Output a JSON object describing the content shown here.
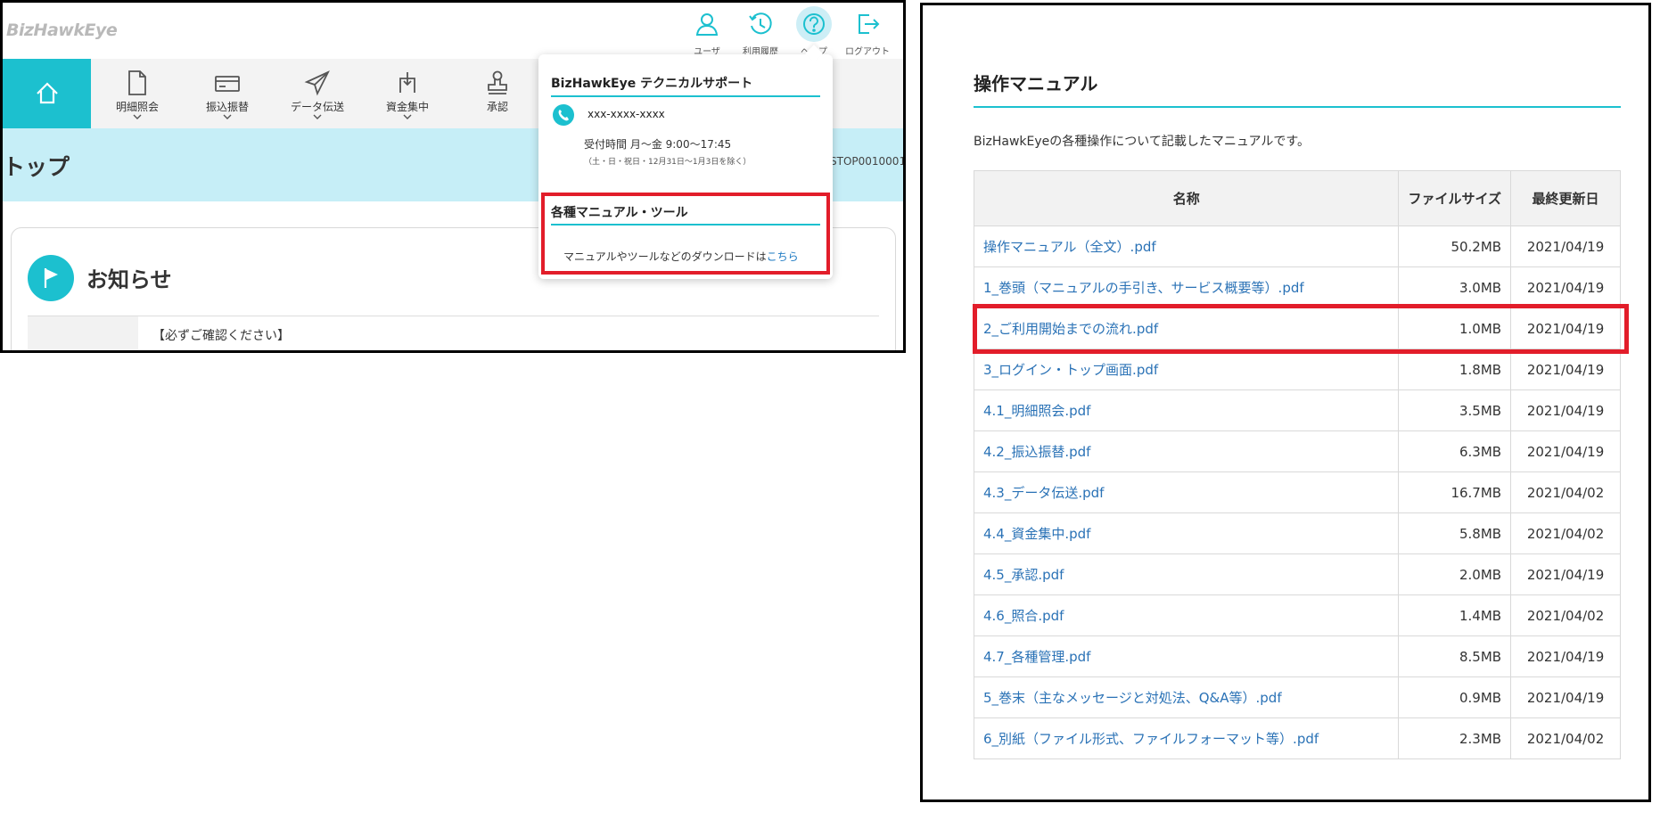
{
  "app": {
    "logo": "BizHawkEye"
  },
  "util_nav": [
    {
      "label": "ユーザ",
      "icon": "user-icon"
    },
    {
      "label": "利用履歴",
      "icon": "history-icon"
    },
    {
      "label": "ヘルプ",
      "icon": "help-icon"
    },
    {
      "label": "ログアウト",
      "icon": "logout-icon"
    }
  ],
  "main_menu": [
    {
      "label": "明細照会",
      "icon": "document-icon",
      "has_chevron": true
    },
    {
      "label": "振込振替",
      "icon": "card-icon",
      "has_chevron": true
    },
    {
      "label": "データ伝送",
      "icon": "paper-plane-icon",
      "has_chevron": true
    },
    {
      "label": "資金集中",
      "icon": "fund-concentrate-icon",
      "has_chevron": true
    },
    {
      "label": "承認",
      "icon": "stamp-icon",
      "has_chevron": false
    }
  ],
  "page": {
    "title": "トップ",
    "screen_id": "STOP0010001"
  },
  "notice": {
    "title": "お知らせ",
    "text": "【必ずご確認ください】"
  },
  "help_popover": {
    "support_heading": "BizHawkEye テクニカルサポート",
    "phone": "xxx-xxxx-xxxx",
    "hours": "受付時間 月～金 9:00～17:45",
    "hours_note": "（土・日・祝日・12月31日～1月3日を除く）",
    "manual_heading": "各種マニュアル・ツール",
    "manual_text": "マニュアルやツールなどのダウンロードは",
    "manual_link": "こちら"
  },
  "manual_page": {
    "title": "操作マニュアル",
    "description": "BizHawkEyeの各種操作について記載したマニュアルです。",
    "columns": [
      "名称",
      "ファイルサイズ",
      "最終更新日"
    ],
    "rows": [
      {
        "name": "操作マニュアル（全文）.pdf",
        "size": "50.2MB",
        "date": "2021/04/19"
      },
      {
        "name": "1_巻頭（マニュアルの手引き、サービス概要等）.pdf",
        "size": "3.0MB",
        "date": "2021/04/19"
      },
      {
        "name": "2_ご利用開始までの流れ.pdf",
        "size": "1.0MB",
        "date": "2021/04/19"
      },
      {
        "name": "3_ログイン・トップ画面.pdf",
        "size": "1.8MB",
        "date": "2021/04/19"
      },
      {
        "name": "4.1_明細照会.pdf",
        "size": "3.5MB",
        "date": "2021/04/19"
      },
      {
        "name": "4.2_振込振替.pdf",
        "size": "6.3MB",
        "date": "2021/04/19"
      },
      {
        "name": "4.3_データ伝送.pdf",
        "size": "16.7MB",
        "date": "2021/04/02"
      },
      {
        "name": "4.4_資金集中.pdf",
        "size": "5.8MB",
        "date": "2021/04/02"
      },
      {
        "name": "4.5_承認.pdf",
        "size": "2.0MB",
        "date": "2021/04/19"
      },
      {
        "name": "4.6_照合.pdf",
        "size": "1.4MB",
        "date": "2021/04/02"
      },
      {
        "name": "4.7_各種管理.pdf",
        "size": "8.5MB",
        "date": "2021/04/19"
      },
      {
        "name": "5_巻末（主なメッセージと対処法、Q&A等）.pdf",
        "size": "0.9MB",
        "date": "2021/04/19"
      },
      {
        "name": "6_別紙（ファイル形式、ファイルフォーマット等）.pdf",
        "size": "2.3MB",
        "date": "2021/04/02"
      }
    ]
  },
  "colors": {
    "accent": "#1cc0cf",
    "highlight": "#e21d2a",
    "link": "#2a72b6",
    "title_band": "#c6eef7"
  }
}
